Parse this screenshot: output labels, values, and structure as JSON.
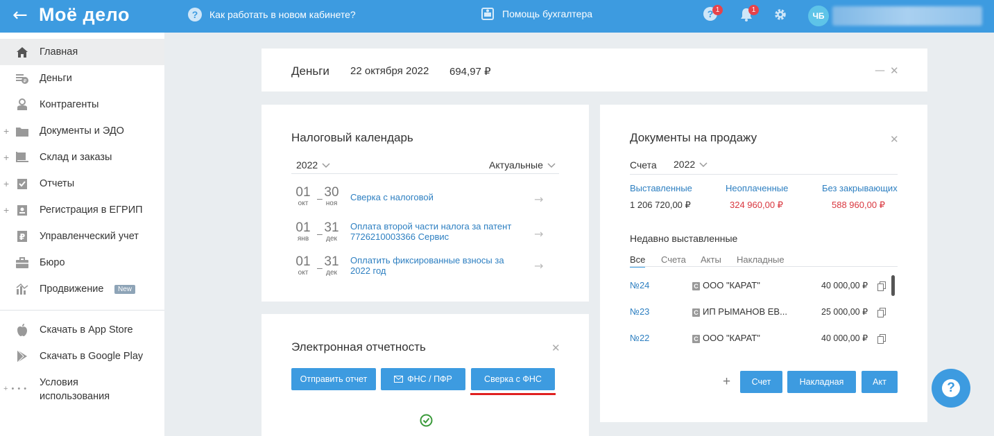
{
  "header": {
    "back_glyph": "←",
    "logo": "Моё дело",
    "howto": "Как работать в новом кабинете?",
    "howto_icon": "?",
    "accountant_help": "Помощь бухгалтера",
    "help_badge": "1",
    "bell_badge": "1",
    "avatar": "ЧБ"
  },
  "sidebar": {
    "items": [
      {
        "label": "Главная",
        "icon": "home-icon"
      },
      {
        "label": "Деньги",
        "icon": "money-icon"
      },
      {
        "label": "Контрагенты",
        "icon": "contractors-icon"
      },
      {
        "label": "Документы и ЭДО",
        "icon": "folder-icon"
      },
      {
        "label": "Склад и заказы",
        "icon": "warehouse-icon"
      },
      {
        "label": "Отчеты",
        "icon": "reports-icon"
      },
      {
        "label": "Регистрация в ЕГРИП",
        "icon": "registration-icon"
      },
      {
        "label": "Управленческий учет",
        "icon": "ruble-doc-icon"
      },
      {
        "label": "Бюро",
        "icon": "briefcase-icon"
      },
      {
        "label": "Продвижение",
        "icon": "chart-icon"
      }
    ],
    "new_badge": "New",
    "plus": "+",
    "app_store": "Скачать в App Store",
    "google_play": "Скачать в Google Play",
    "terms_line1": "Условия",
    "terms_line2": "использования",
    "terms_prefix": "+ • • •"
  },
  "money": {
    "title": "Деньги",
    "date": "22 октября 2022",
    "amount": "694,97 ₽",
    "minimize": "—",
    "close": "✕"
  },
  "tax_calendar": {
    "title": "Налоговый календарь",
    "year": "2022",
    "filter": "Актуальные",
    "dash": "–",
    "arrow": "→",
    "events": [
      {
        "from_day": "01",
        "from_month": "окт",
        "to_day": "30",
        "to_month": "ноя",
        "text": "Сверка с налоговой"
      },
      {
        "from_day": "01",
        "from_month": "янв",
        "to_day": "31",
        "to_month": "дек",
        "text": "Оплата второй части налога за патент 7726210003366 Сервис"
      },
      {
        "from_day": "01",
        "from_month": "окт",
        "to_day": "31",
        "to_month": "дек",
        "text": "Оплатить фиксированные взносы за 2022 год"
      }
    ]
  },
  "e_reporting": {
    "title": "Электронная отчетность",
    "close": "✕",
    "buttons": [
      "Отправить отчет",
      "ФНС / ПФР",
      "Сверка с ФНС"
    ]
  },
  "sales_docs": {
    "title": "Документы на продажу",
    "close": "✕",
    "type_label": "Счета",
    "year": "2022",
    "stats": [
      {
        "label": "Выставленные",
        "value": "1 206 720,00 ₽"
      },
      {
        "label": "Неоплаченные",
        "value": "324 960,00 ₽"
      },
      {
        "label": "Без закрывающих",
        "value": "588 960,00 ₽"
      }
    ],
    "recent_title": "Недавно выставленные",
    "tabs": [
      "Все",
      "Счета",
      "Акты",
      "Накладные"
    ],
    "rows": [
      {
        "num": "№24",
        "party": "ООО \"КАРАТ\"",
        "amount": "40 000,00 ₽"
      },
      {
        "num": "№23",
        "party": "ИП РЫМАНОВ ЕВ...",
        "amount": "25 000,00 ₽"
      },
      {
        "num": "№22",
        "party": "ООО \"КАРАТ\"",
        "amount": "40 000,00 ₽"
      }
    ],
    "company_mark": "С",
    "add": "+",
    "create_buttons": [
      "Счет",
      "Накладная",
      "Акт"
    ]
  },
  "help_fab": "?",
  "colors": {
    "accent": "#3d9be0",
    "link": "#2d7fc1",
    "danger": "#d9363e",
    "underline": "#e02020"
  }
}
